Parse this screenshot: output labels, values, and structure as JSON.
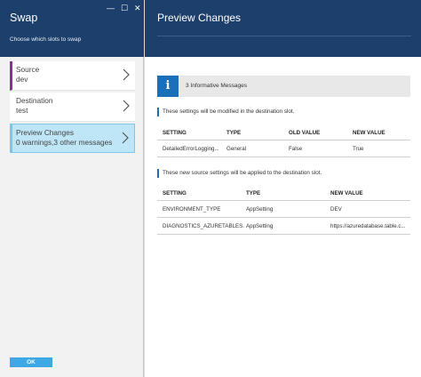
{
  "left_blade": {
    "title": "Swap",
    "subtitle": "Choose which slots to swap",
    "window_controls": {
      "minimize": "—",
      "maximize": "☐",
      "close": "✕"
    },
    "steps": [
      {
        "label": "Source",
        "value": "dev"
      },
      {
        "label": "Destination",
        "value": "test"
      },
      {
        "label": "Preview Changes",
        "value": "0 warnings,3 other messages"
      }
    ],
    "ok_label": "OK"
  },
  "right_blade": {
    "title": "Preview Changes",
    "info": {
      "icon": "i",
      "message": "3 Informative Messages"
    },
    "section1": {
      "heading": "These settings will be modified in the destination slot.",
      "columns": [
        "SETTING",
        "TYPE",
        "OLD VALUE",
        "NEW VALUE"
      ],
      "rows": [
        [
          "DetailedErrorLogging...",
          "General",
          "False",
          "True"
        ]
      ]
    },
    "section2": {
      "heading": "These new source settings will be applied to the destination slot.",
      "columns": [
        "SETTING",
        "TYPE",
        "NEW VALUE"
      ],
      "rows": [
        [
          "ENVIRONMENT_TYPE",
          "AppSetting",
          "DEV"
        ],
        [
          "DIAGNOSTICS_AZURETABLES...",
          "AppSetting",
          "https://azuredatabase.table.c..."
        ]
      ]
    }
  },
  "colors": {
    "header_bg": "#1c3f6b",
    "accent_blue": "#1a6fb8",
    "active_step": "#bfe6f7",
    "source_marker": "#8b2f96",
    "ok_button": "#3ea8e5"
  },
  "icons": {
    "info": "info-icon",
    "chevron": "chevron-right-icon"
  }
}
